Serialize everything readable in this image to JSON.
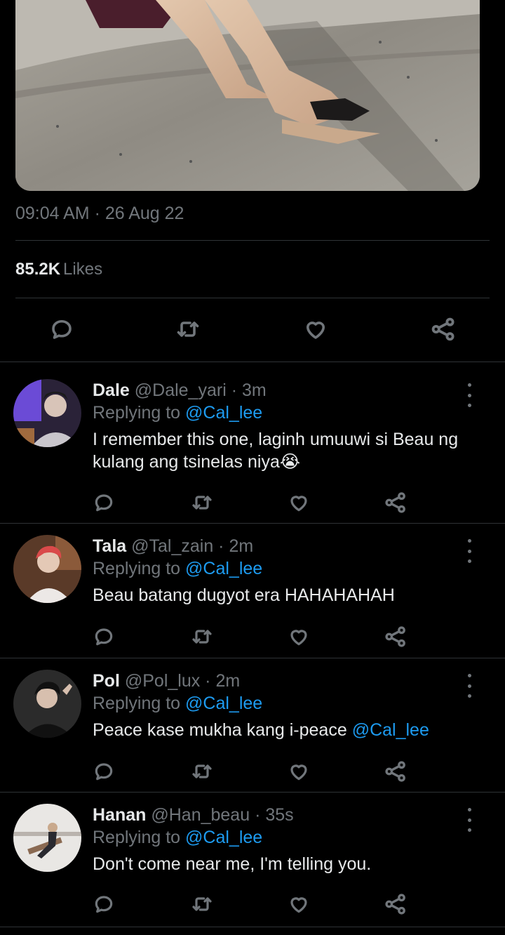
{
  "tweet": {
    "timestamp": "09:04 AM · 26 Aug 22",
    "likes_count": "85.2K",
    "likes_label": "Likes"
  },
  "icons": {
    "reply": "comment-bubble-icon",
    "retweet": "retweet-arrows-icon",
    "like": "heart-icon",
    "share": "share-nodes-icon",
    "more": "vertical-ellipsis-icon"
  },
  "colors": {
    "background": "#000000",
    "text": "#e7e9ea",
    "muted": "#71767b",
    "accent": "#1d9bf0",
    "divider": "#2f3336"
  },
  "replies": [
    {
      "name": "Dale",
      "meta": "@Dale_yari · 3m",
      "replying_label": "Replying to",
      "replying_to": "@Cal_lee",
      "text": "I remember this one, laginh umuuwi si Beau ng kulang ang tsinelas niya😭",
      "text_mention": ""
    },
    {
      "name": "Tala",
      "meta": "@Tal_zain · 2m",
      "replying_label": "Replying to",
      "replying_to": "@Cal_lee",
      "text": "Beau batang dugyot era HAHAHAHAH",
      "text_mention": ""
    },
    {
      "name": "Pol",
      "meta": "@Pol_lux · 2m",
      "replying_label": "Replying to",
      "replying_to": "@Cal_lee",
      "text": "Peace kase mukha kang i-peace",
      "text_mention": "@Cal_lee"
    },
    {
      "name": "Hanan",
      "meta": "@Han_beau · 35s",
      "replying_label": "Replying to",
      "replying_to": "@Cal_lee",
      "text": "Don't come near me, I'm telling you.",
      "text_mention": ""
    }
  ]
}
